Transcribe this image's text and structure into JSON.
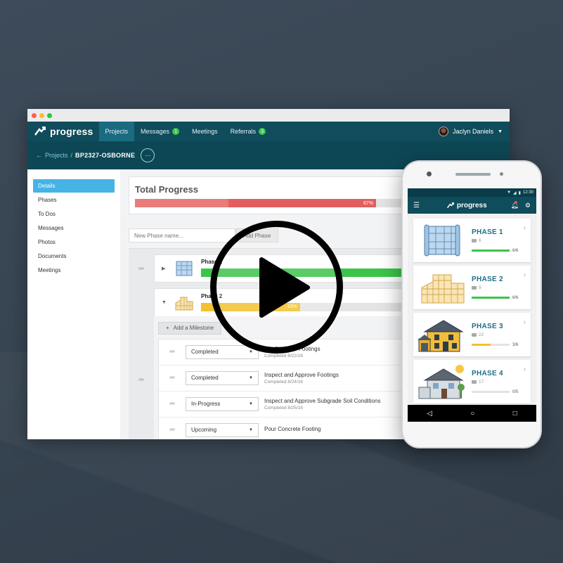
{
  "colors": {
    "accent": "#0f4c5c",
    "active_nav": "#1a6b80",
    "sidebar_active": "#47b2e6",
    "red": "#e25f5f",
    "green": "#3cc44a",
    "yellow": "#f2c230"
  },
  "browser": {
    "brand": "progress",
    "nav": [
      {
        "label": "Projects",
        "active": true
      },
      {
        "label": "Messages",
        "badge": "1"
      },
      {
        "label": "Meetings"
      },
      {
        "label": "Referrals",
        "badge": "3"
      }
    ],
    "user": "Jaclyn Daniels",
    "breadcrumb": {
      "back_arrow": "←",
      "parent": "Projects",
      "separator": "/",
      "current": "BP2327-OSBORNE",
      "more": "···"
    },
    "sidebar": [
      "Details",
      "Phases",
      "To Dos",
      "Messages",
      "Photos",
      "Documents",
      "Meetings"
    ],
    "total_progress": {
      "title": "Total Progress",
      "percent_label": "67%",
      "value": 0.67
    },
    "phase_input_placeholder": "New Phase name...",
    "add_phase_label": "Add Phase",
    "phases": [
      {
        "name": "Phase 1",
        "progress": 1.0,
        "icon": "blueprint-icon"
      },
      {
        "name": "Phase 2",
        "progress": 0.33,
        "label": "33%",
        "icon": "framing-icon"
      }
    ],
    "add_milestone_label": "Add a Milestone",
    "milestones": [
      {
        "status": "Completed",
        "title": "Dig Concrete Footings",
        "date": "Completed 8/22/16"
      },
      {
        "status": "Completed",
        "title": "Inspect and Approve Footings",
        "date": "Completed 8/24/16"
      },
      {
        "status": "In-Progress",
        "title": "Inspect and Approve Subgrade Soil Conditions",
        "date": "Completed 8/25/16"
      },
      {
        "status": "Upcoming",
        "title": "Pour Concrete Footing",
        "date": ""
      }
    ]
  },
  "phone": {
    "time": "12:30",
    "brand": "progress",
    "phases": [
      {
        "name": "PHASE 1",
        "photos": "6",
        "count": "6/6",
        "progress": 1.0,
        "color": "#3cc44a",
        "icon": "blueprint-icon"
      },
      {
        "name": "PHASE 2",
        "photos": "9",
        "count": "6/6",
        "progress": 1.0,
        "color": "#3cc44a",
        "icon": "framing-icon"
      },
      {
        "name": "PHASE 3",
        "photos": "22",
        "count": "3/6",
        "progress": 0.5,
        "color": "#f2c230",
        "icon": "house-exterior-icon"
      },
      {
        "name": "PHASE 4",
        "photos": "17",
        "count": "0/5",
        "progress": 0.0,
        "color": "#3cc44a",
        "icon": "finished-house-icon"
      }
    ]
  }
}
